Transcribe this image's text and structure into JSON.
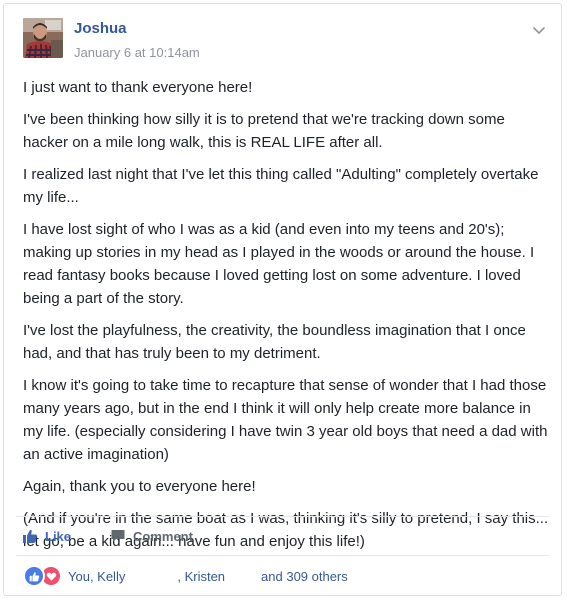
{
  "post": {
    "author": "Joshua",
    "timestamp": "January 6 at 10:14am",
    "paragraphs": [
      "I just want to thank everyone here!",
      "I've been thinking how silly it is to pretend that we're tracking down some hacker on a mile long walk, this is REAL LIFE after all.",
      "I realized last night that I've let this thing called \"Adulting\" completely overtake my life...",
      "I have lost sight of who I was as a kid (and even into my teens and 20's); making up stories in my head as I played in the woods or around the house. I read fantasy books because I loved getting lost on some adventure. I loved being a part of the story.",
      "I've lost the playfulness, the creativity, the boundless imagination that I once had, and that has truly been to my detriment.",
      "I know it's going to take time to recapture that sense of wonder that I had those many years ago, but in the end I think it will only help create more balance in my life. (especially considering I have twin 3 year old boys that need a dad with an active imagination)",
      "Again, thank you to everyone here!",
      "(And if you're in the same boat as I was, thinking it's silly to pretend, I say this... let go, be a kid again... have fun and enjoy this life!)"
    ]
  },
  "actions": {
    "like_label": "Like",
    "comment_label": "Comment"
  },
  "reactions": {
    "names": [
      "You, Kelly",
      ", Kristen"
    ],
    "others": "and 309 others"
  },
  "colors": {
    "link": "#365899",
    "like_blue": "#4267b2",
    "love_red": "#f0506e",
    "muted": "#90949c"
  },
  "icons": {
    "menu": "chevron-down-icon",
    "like": "thumbs-up-icon",
    "comment": "speech-bubble-icon",
    "reaction_like": "like-reaction-icon",
    "reaction_love": "love-reaction-icon"
  }
}
